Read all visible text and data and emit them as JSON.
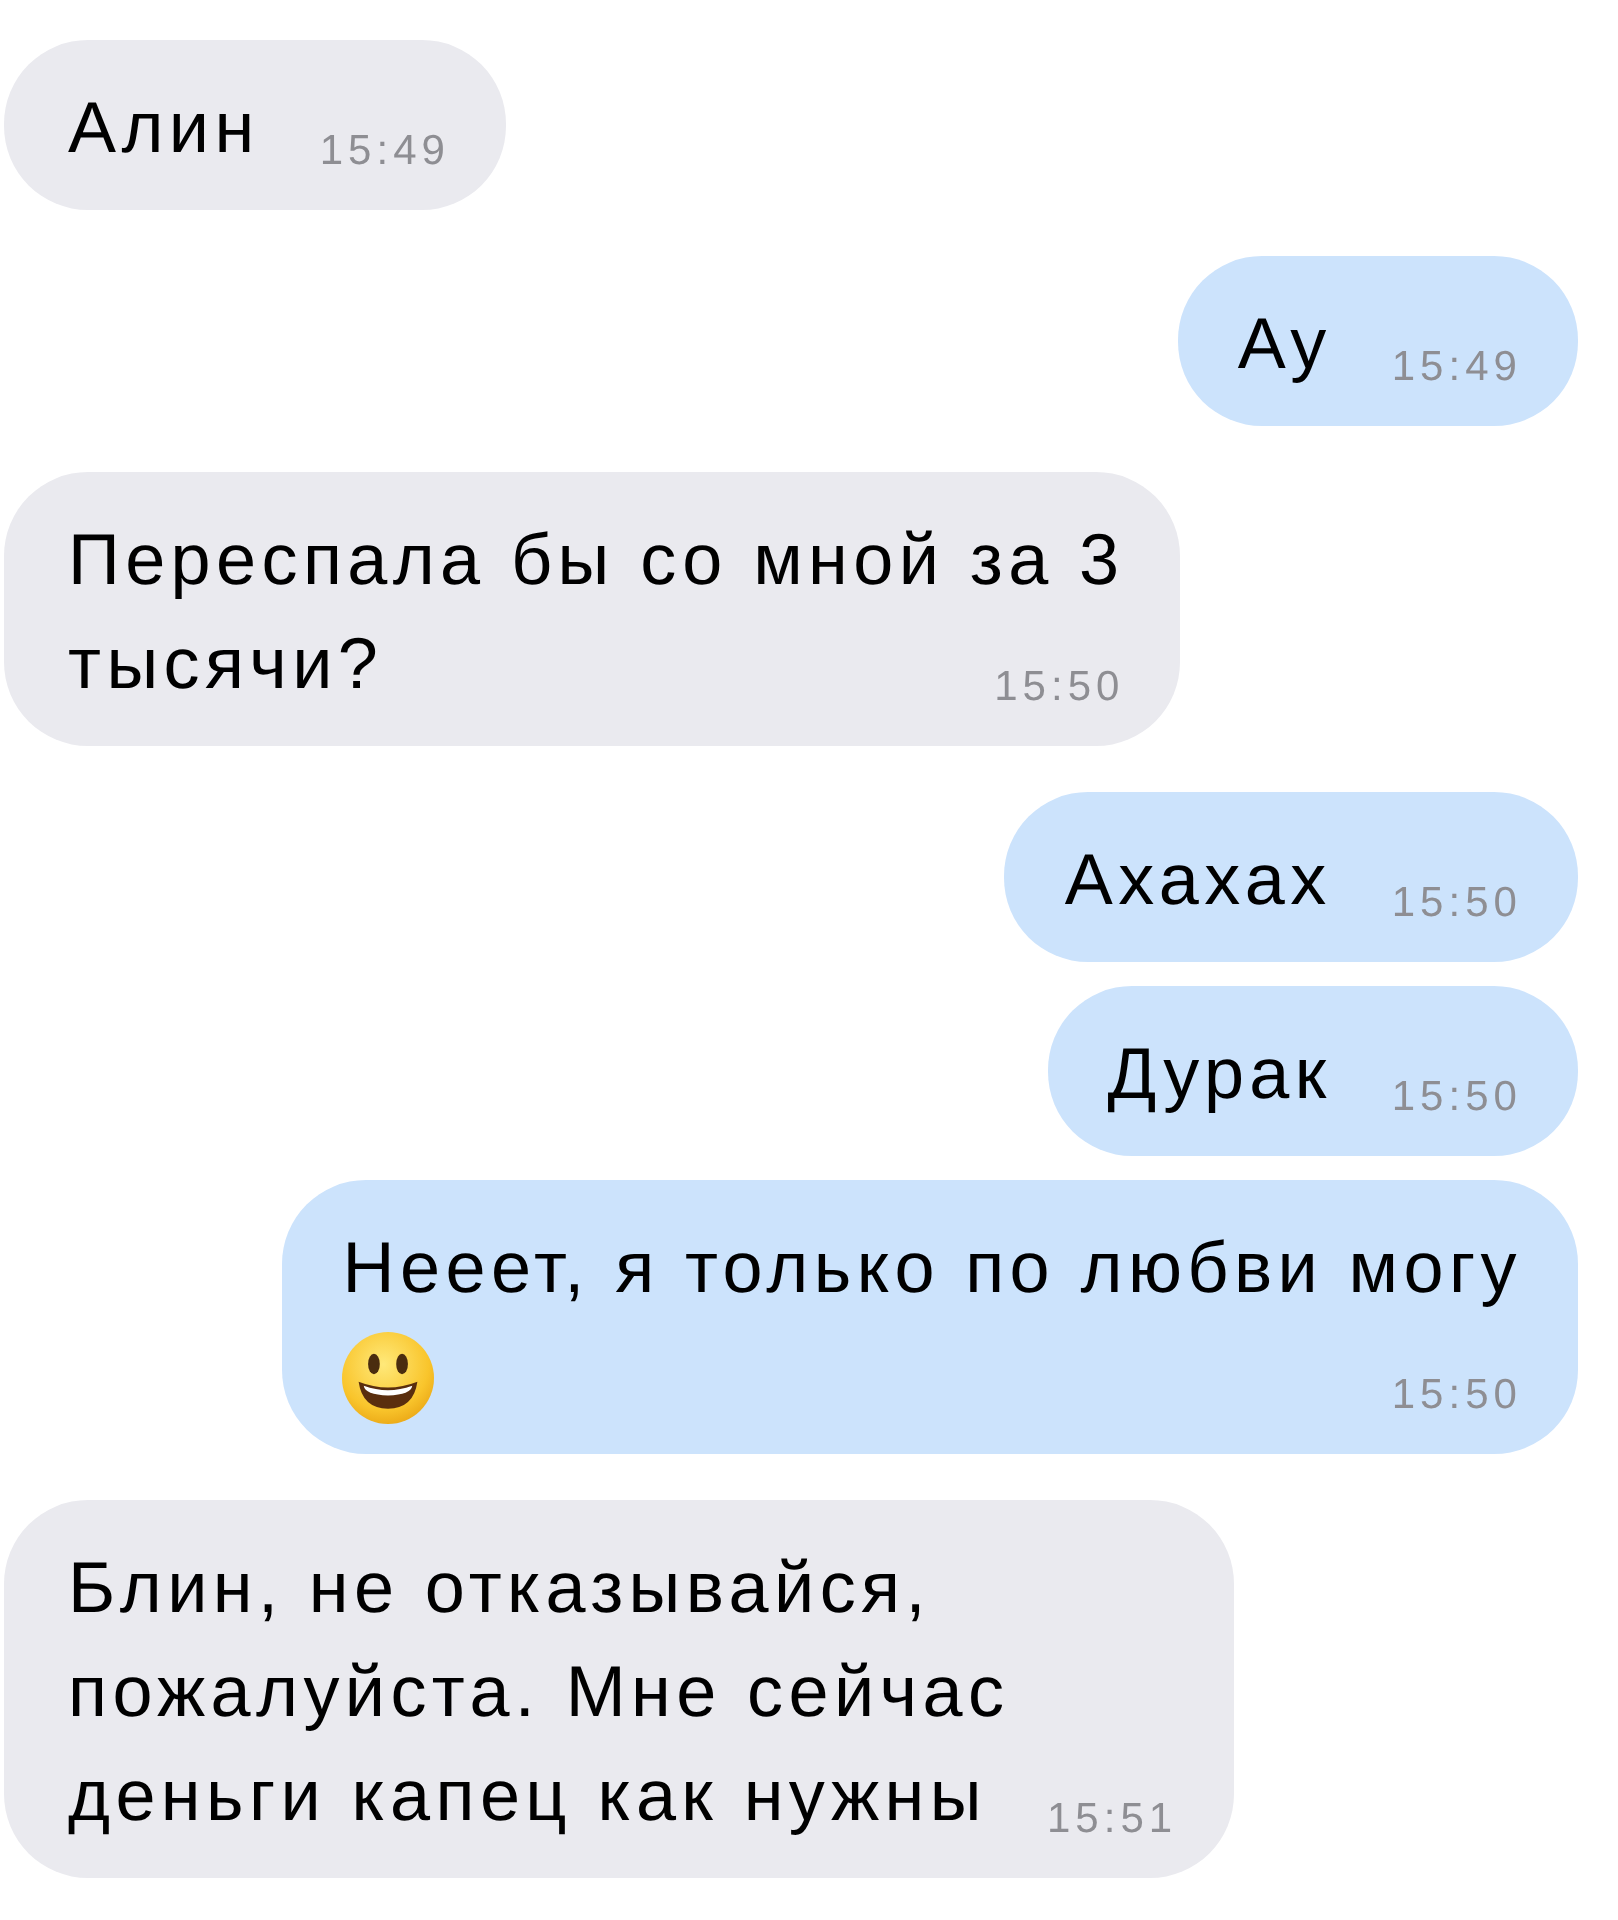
{
  "messages": [
    {
      "outgoing": false,
      "lines": [
        {
          "kind": "text",
          "text": "Алин"
        }
      ],
      "time": "15:49"
    },
    {
      "outgoing": true,
      "lines": [
        {
          "kind": "text",
          "text": "Ау"
        }
      ],
      "time": "15:49"
    },
    {
      "outgoing": false,
      "lines": [
        {
          "kind": "text",
          "text": "Переспала бы со мной за 3"
        },
        {
          "kind": "text",
          "text": "тысячи?"
        }
      ],
      "time": "15:50"
    },
    {
      "outgoing": true,
      "lines": [
        {
          "kind": "text",
          "text": "Ахахах"
        }
      ],
      "time": "15:50"
    },
    {
      "outgoing": true,
      "lines": [
        {
          "kind": "text",
          "text": "Дурак"
        }
      ],
      "time": "15:50"
    },
    {
      "outgoing": true,
      "lines": [
        {
          "kind": "text",
          "text": "Нееет, я только по любви могу"
        },
        {
          "kind": "emoji"
        }
      ],
      "time": "15:50"
    },
    {
      "outgoing": false,
      "lines": [
        {
          "kind": "text",
          "text": "Блин, не отказывайся,"
        },
        {
          "kind": "text",
          "text": "пожалуйста. Мне сейчас"
        },
        {
          "kind": "text",
          "text": "деньги капец как нужны"
        }
      ],
      "time": "15:51"
    }
  ]
}
